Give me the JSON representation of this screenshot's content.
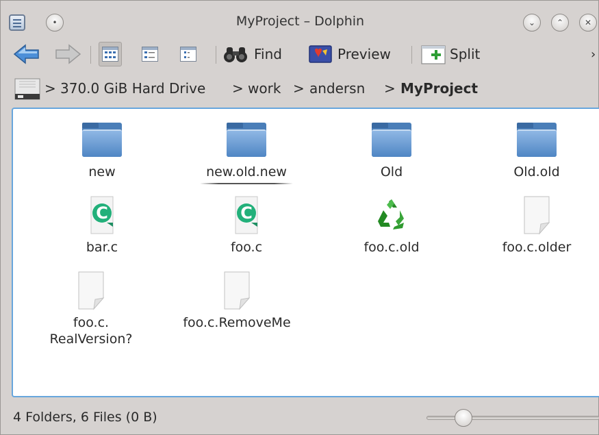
{
  "window": {
    "title": "MyProject – Dolphin",
    "buttons": [
      "minimize",
      "maximize",
      "close"
    ]
  },
  "toolbar": {
    "find_label": "Find",
    "preview_label": "Preview",
    "split_label": "Split",
    "overflow_label": "›",
    "active_view": "icons"
  },
  "breadcrumb": {
    "separator": ">",
    "segments": [
      "370.0 GiB Hard Drive",
      "work",
      "andersn",
      "MyProject"
    ]
  },
  "files": [
    {
      "name": "new",
      "kind": "folder",
      "icon": "folder-icon"
    },
    {
      "name": "new.old.new",
      "kind": "folder",
      "icon": "folder-icon",
      "hovered": true
    },
    {
      "name": "Old",
      "kind": "folder",
      "icon": "folder-icon"
    },
    {
      "name": "Old.old",
      "kind": "folder",
      "icon": "folder-icon"
    },
    {
      "name": "bar.c",
      "kind": "c-source",
      "icon": "c-source-file-icon"
    },
    {
      "name": "foo.c",
      "kind": "c-source",
      "icon": "c-source-file-icon"
    },
    {
      "name": "foo.c.old",
      "kind": "backup",
      "icon": "recycle-file-icon"
    },
    {
      "name": "foo.c.older",
      "kind": "unknown",
      "icon": "blank-file-icon"
    },
    {
      "name": "foo.c.\nRealVersion?",
      "kind": "unknown",
      "icon": "blank-file-icon"
    },
    {
      "name": "foo.c.RemoveMe",
      "kind": "unknown",
      "icon": "blank-file-icon"
    }
  ],
  "status": {
    "summary": "4 Folders, 6 Files (0 B)",
    "zoom_level": 0.18
  },
  "colors": {
    "accent": "#67a6dd",
    "folder": "#4a7eb8",
    "window_bg": "#d6d2d0"
  }
}
